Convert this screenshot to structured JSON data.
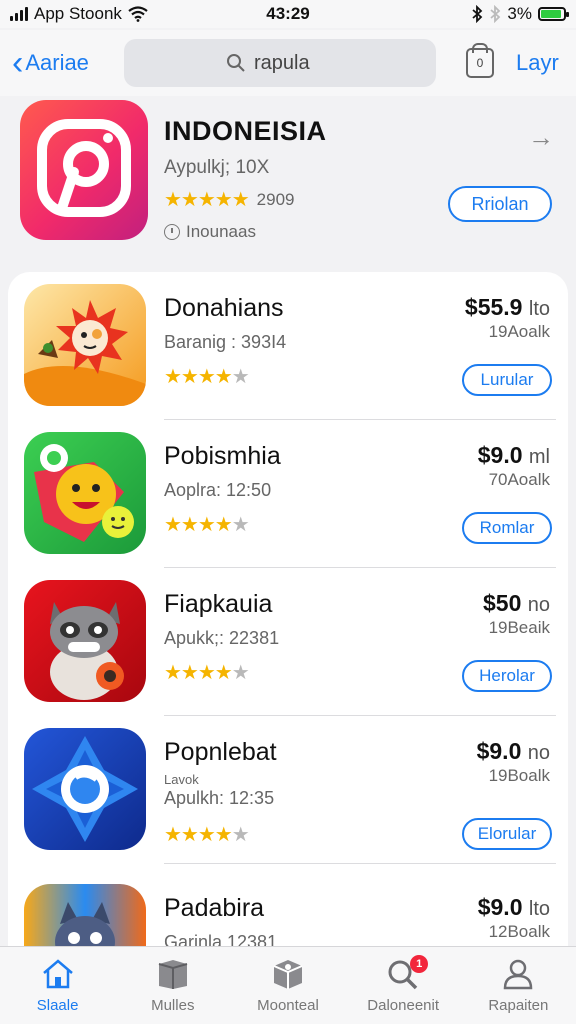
{
  "status_bar": {
    "carrier": "App Stoonk",
    "time": "43:29",
    "battery": "3%"
  },
  "nav": {
    "back_label": "Aariae",
    "search_value": "rapula",
    "bag_count": "0",
    "right_label": "Layr"
  },
  "featured": {
    "title": "INDONEISIA",
    "subtitle": "Aypulkj; 10X",
    "rating_stars": "★★★★★",
    "rating_count": "2909",
    "category": "Inounaas",
    "button_label": "Rriolan",
    "arrow": "→"
  },
  "apps": [
    {
      "name": "Donahians",
      "subtitle": "Baranig : 393I4",
      "price": "$55.9",
      "price_unit": "lto",
      "count": "19Aoalk",
      "button": "Lurular",
      "extra": ""
    },
    {
      "name": "Pobismhia",
      "subtitle": "Aoplra: 12:50",
      "price": "$9.0",
      "price_unit": "ml",
      "count": "70Aoalk",
      "button": "Romlar",
      "extra": ""
    },
    {
      "name": "Fiapkauia",
      "subtitle": "Apukk;: 22381",
      "price": "$50",
      "price_unit": "no",
      "count": "19Beaik",
      "button": "Herolar",
      "extra": ""
    },
    {
      "name": "Popnlebat",
      "subtitle": "Apulkh: 12:35",
      "price": "$9.0",
      "price_unit": "no",
      "count": "19Boalk",
      "button": "Elorular",
      "extra": "Lavok"
    },
    {
      "name": "Padabira",
      "subtitle": "Garinla 12381",
      "price": "$9.0",
      "price_unit": "lto",
      "count": "12Boalk",
      "button": "",
      "extra": ""
    }
  ],
  "rating_four": "★★★★",
  "rating_empty": "★",
  "tabs": [
    {
      "label": "Slaale",
      "icon": "home-icon"
    },
    {
      "label": "Mulles",
      "icon": "box-icon"
    },
    {
      "label": "Moonteal",
      "icon": "cube-icon"
    },
    {
      "label": "Daloneenit",
      "icon": "search-icon",
      "badge": "1"
    },
    {
      "label": "Rapaiten",
      "icon": "person-icon"
    }
  ],
  "colors": {
    "accent": "#1c7cf0",
    "star": "#f5b400",
    "badge": "#f2263c"
  }
}
